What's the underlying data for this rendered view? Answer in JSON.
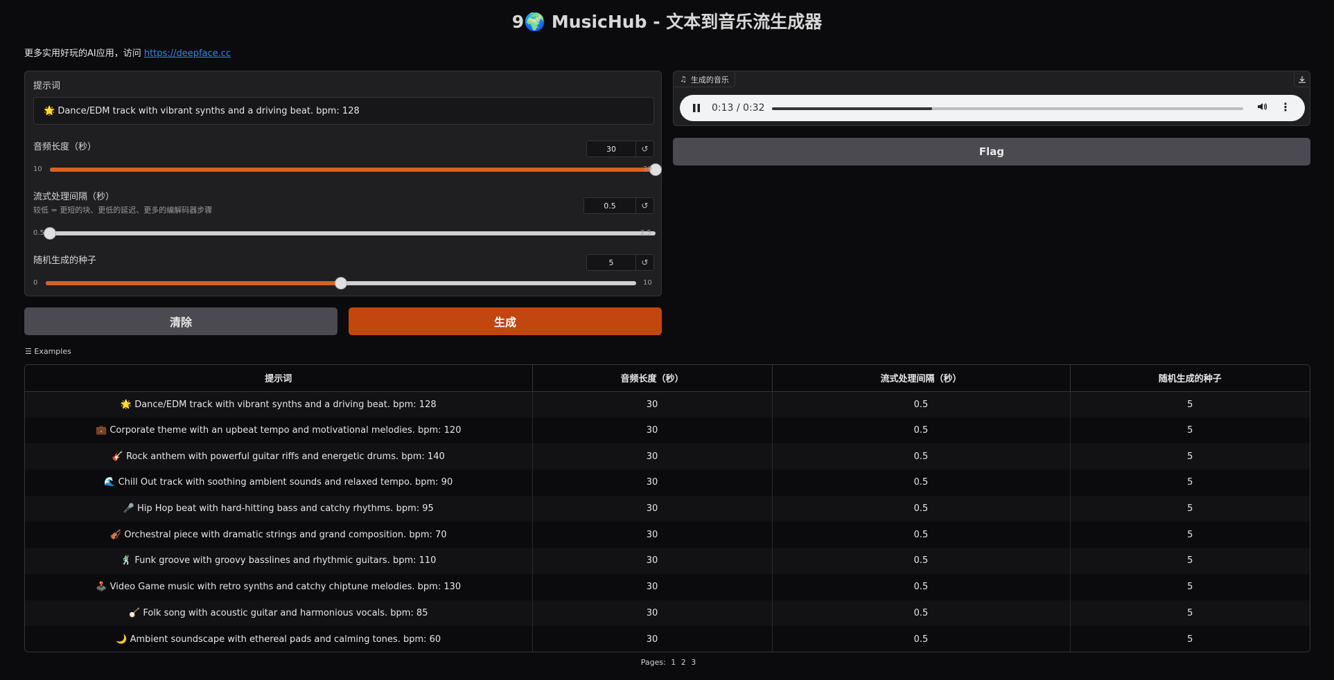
{
  "header": {
    "title": "9🌍 MusicHub - 文本到音乐流生成器",
    "subtitle_text": "更多实用好玩的AI应用，访问",
    "subtitle_link": "https://deepface.cc"
  },
  "form": {
    "prompt_label": "提示词",
    "prompt_value": "🌟 Dance/EDM track with vibrant synths and a driving beat. bpm: 128",
    "duration": {
      "label": "音频长度（秒）",
      "value": "30",
      "min": "10",
      "max": "30",
      "fraction": 1.0
    },
    "interval": {
      "label": "流式处理间隔（秒）",
      "info": "较低 = 更短的块、更低的延迟、更多的编解码器步骤",
      "value": "0.5",
      "min": "0.5",
      "max": "2.5",
      "fraction": 0.0
    },
    "seed": {
      "label": "随机生成的种子",
      "value": "5",
      "min": "0",
      "max": "10",
      "fraction": 0.5
    },
    "reset_glyph": "↺"
  },
  "buttons": {
    "clear": "清除",
    "generate": "生成",
    "flag": "Flag"
  },
  "audio": {
    "label": "生成的音乐",
    "time": "0:13 / 0:32",
    "progress": 0.34
  },
  "examples": {
    "label": "Examples",
    "headers": [
      "提示词",
      "音频长度（秒）",
      "流式处理间隔（秒）",
      "随机生成的种子"
    ],
    "rows": [
      [
        "🌟 Dance/EDM track with vibrant synths and a driving beat. bpm: 128",
        "30",
        "0.5",
        "5"
      ],
      [
        "💼 Corporate theme with an upbeat tempo and motivational melodies. bpm: 120",
        "30",
        "0.5",
        "5"
      ],
      [
        "🎸 Rock anthem with powerful guitar riffs and energetic drums. bpm: 140",
        "30",
        "0.5",
        "5"
      ],
      [
        "🌊 Chill Out track with soothing ambient sounds and relaxed tempo. bpm: 90",
        "30",
        "0.5",
        "5"
      ],
      [
        "🎤 Hip Hop beat with hard-hitting bass and catchy rhythms. bpm: 95",
        "30",
        "0.5",
        "5"
      ],
      [
        "🎻 Orchestral piece with dramatic strings and grand composition. bpm: 70",
        "30",
        "0.5",
        "5"
      ],
      [
        "🕺 Funk groove with groovy basslines and rhythmic guitars. bpm: 110",
        "30",
        "0.5",
        "5"
      ],
      [
        "🕹️ Video Game music with retro synths and catchy chiptune melodies. bpm: 130",
        "30",
        "0.5",
        "5"
      ],
      [
        "🪕 Folk song with acoustic guitar and harmonious vocals. bpm: 85",
        "30",
        "0.5",
        "5"
      ],
      [
        "🌙 Ambient soundscape with ethereal pads and calming tones. bpm: 60",
        "30",
        "0.5",
        "5"
      ]
    ]
  },
  "pagination": {
    "label": "Pages:",
    "pages": [
      "1",
      "2",
      "3"
    ]
  }
}
